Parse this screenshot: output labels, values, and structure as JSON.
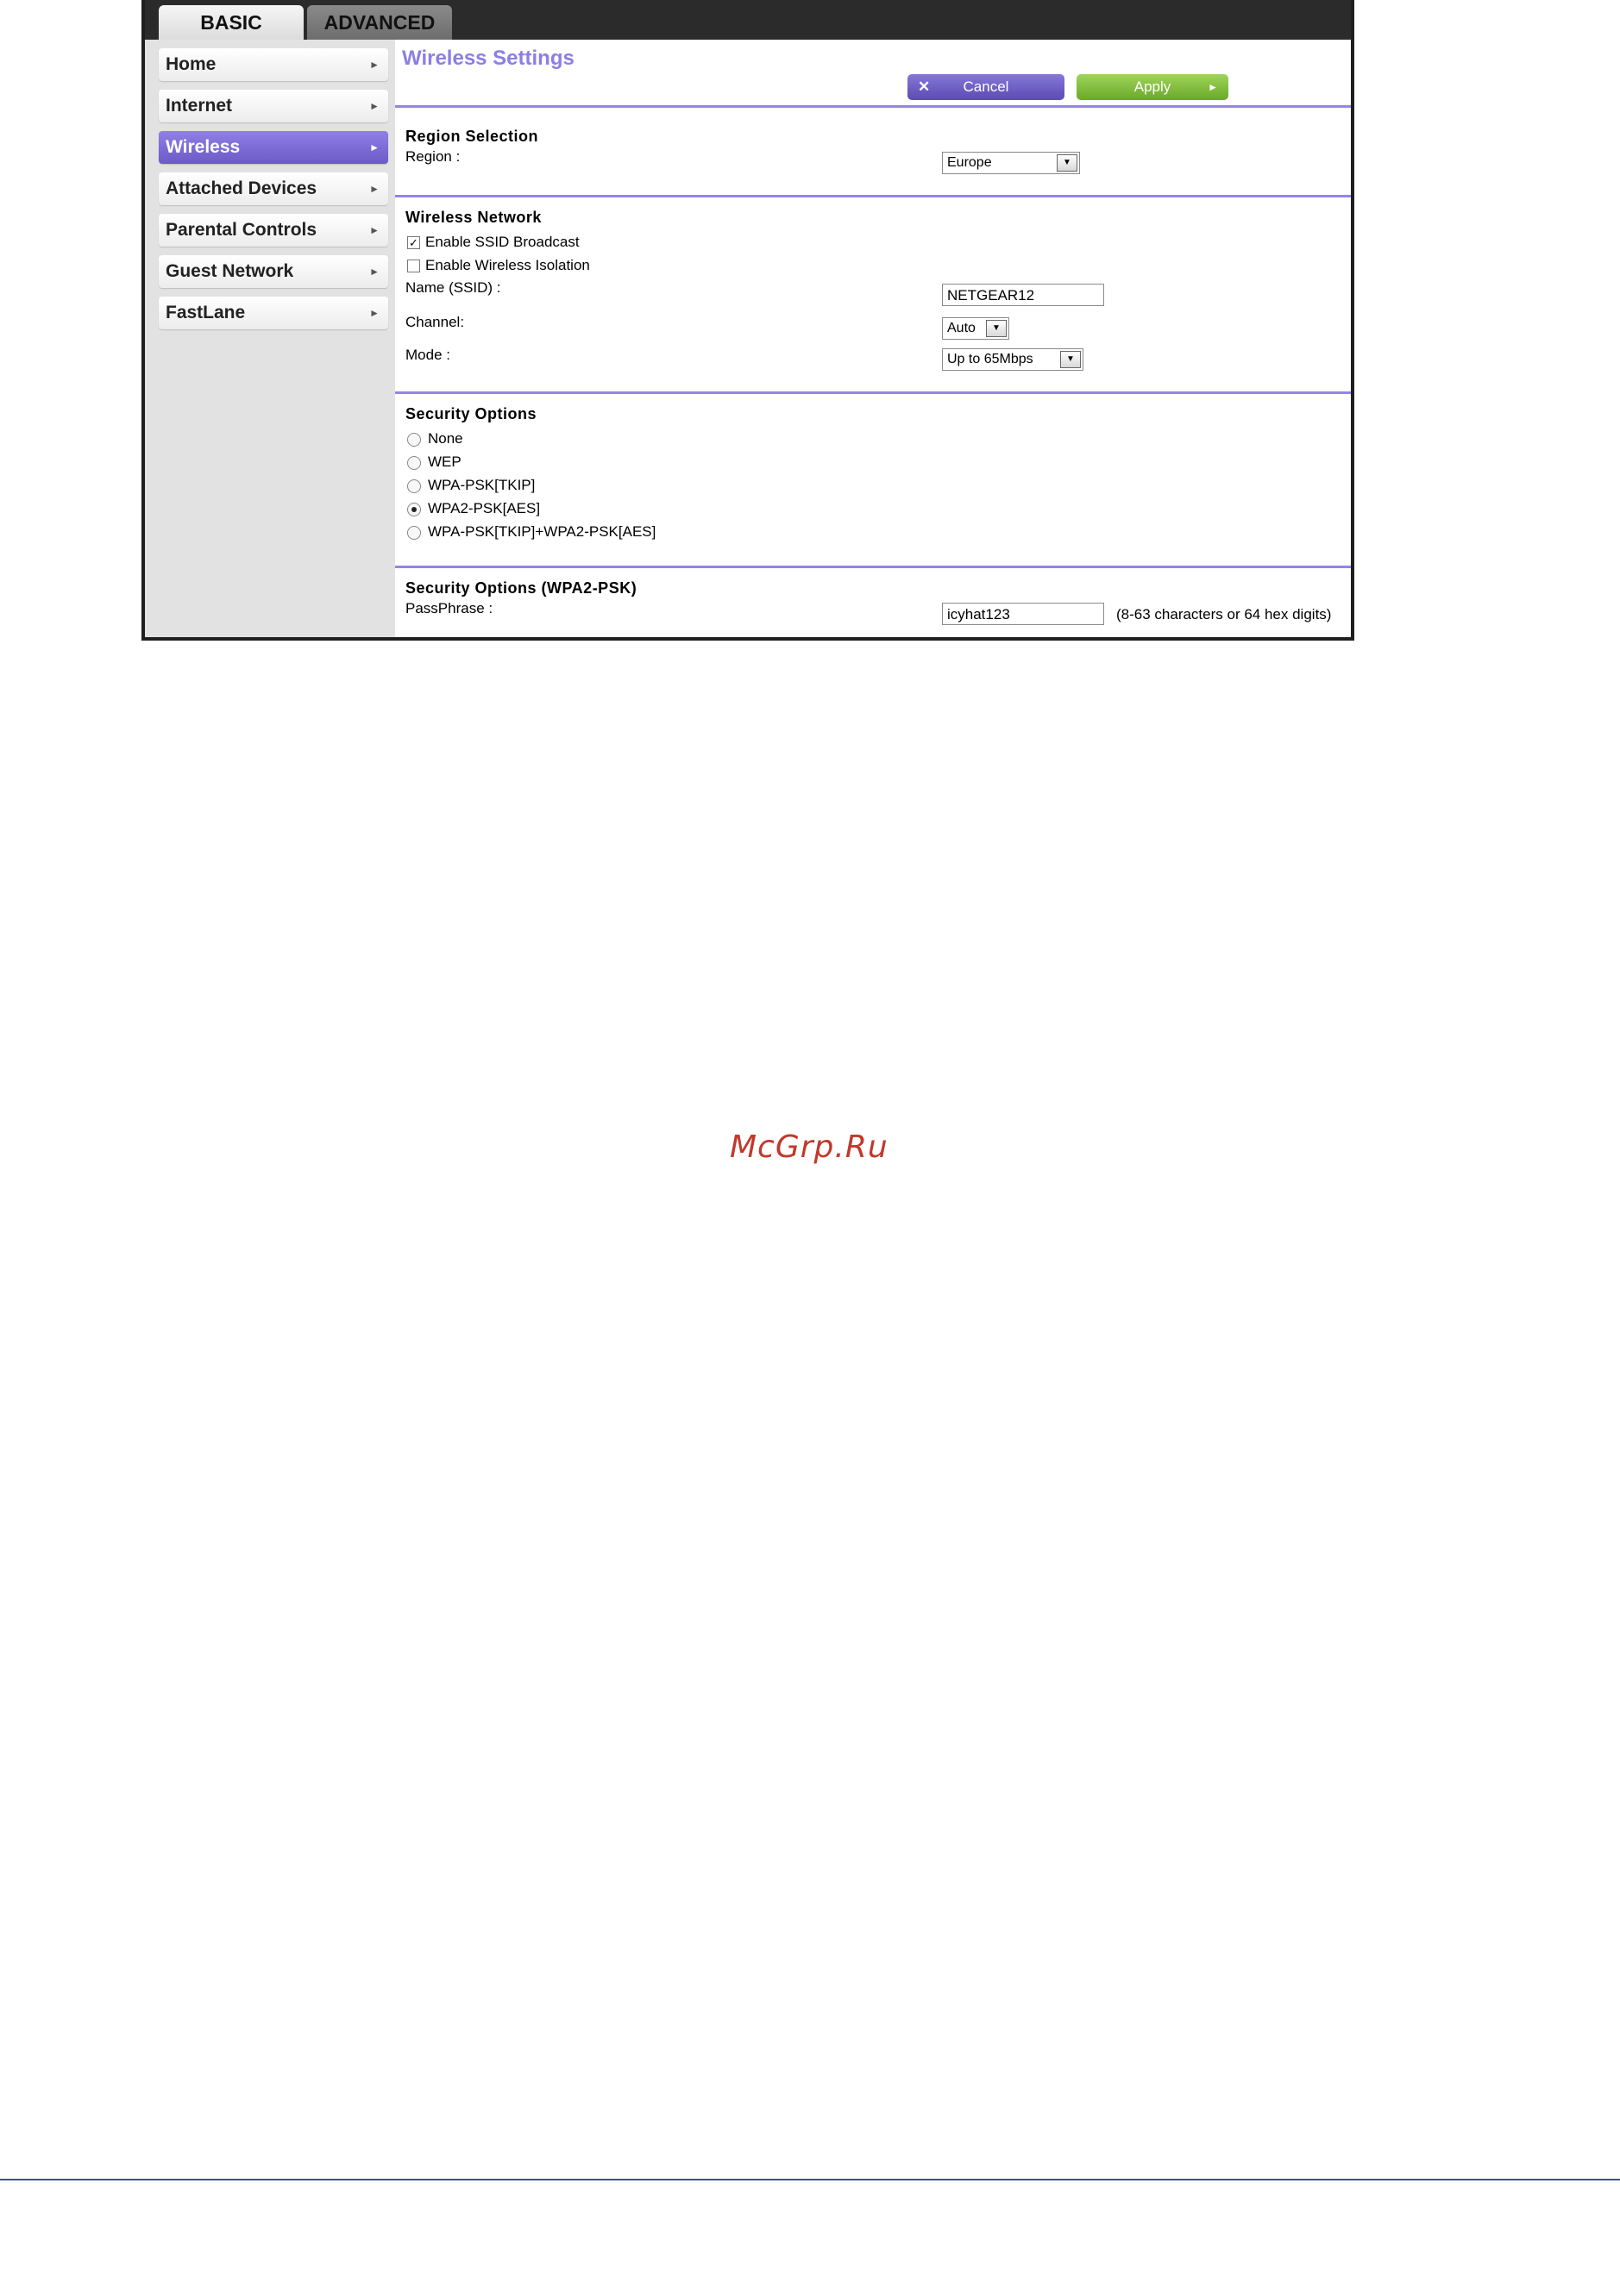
{
  "tabs": {
    "basic": "BASIC",
    "advanced": "ADVANCED"
  },
  "sidebar": {
    "items": [
      {
        "label": "Home"
      },
      {
        "label": "Internet"
      },
      {
        "label": "Wireless"
      },
      {
        "label": "Attached Devices"
      },
      {
        "label": "Parental Controls"
      },
      {
        "label": "Guest Network"
      },
      {
        "label": "FastLane"
      }
    ],
    "active": "Wireless"
  },
  "main": {
    "title": "Wireless Settings",
    "cancel_label": "Cancel",
    "apply_label": "Apply",
    "region": {
      "section_title": "Region Selection",
      "label": "Region :",
      "value": "Europe"
    },
    "network": {
      "section_title": "Wireless Network",
      "ssid_broadcast_label": "Enable SSID Broadcast",
      "ssid_broadcast_checked": true,
      "isolation_label": "Enable Wireless Isolation",
      "isolation_checked": false,
      "name_label": "Name (SSID) :",
      "name_value": "NETGEAR12",
      "channel_label": "Channel:",
      "channel_value": "Auto",
      "mode_label": "Mode :",
      "mode_value": "Up to 65Mbps"
    },
    "security": {
      "section_title": "Security Options",
      "options": [
        "None",
        "WEP",
        "WPA-PSK[TKIP]",
        "WPA2-PSK[AES]",
        "WPA-PSK[TKIP]+WPA2-PSK[AES]"
      ],
      "selected": "WPA2-PSK[AES]"
    },
    "wpa2": {
      "section_title": "Security Options (WPA2-PSK)",
      "passphrase_label": "PassPhrase :",
      "passphrase_value": "icyhat123",
      "passphrase_hint": "(8-63 characters or 64 hex digits)"
    }
  },
  "watermark": "McGrp.Ru",
  "colors": {
    "accent": "#8b7ee6",
    "apply": "#6aa928",
    "cancel": "#5b4bb3",
    "active_nav": "#6c5ac6"
  },
  "icons": {
    "nav_arrow": "chevron-right-icon",
    "cancel": "close-icon",
    "apply": "chevron-right-icon",
    "dropdown": "caret-down-icon"
  }
}
